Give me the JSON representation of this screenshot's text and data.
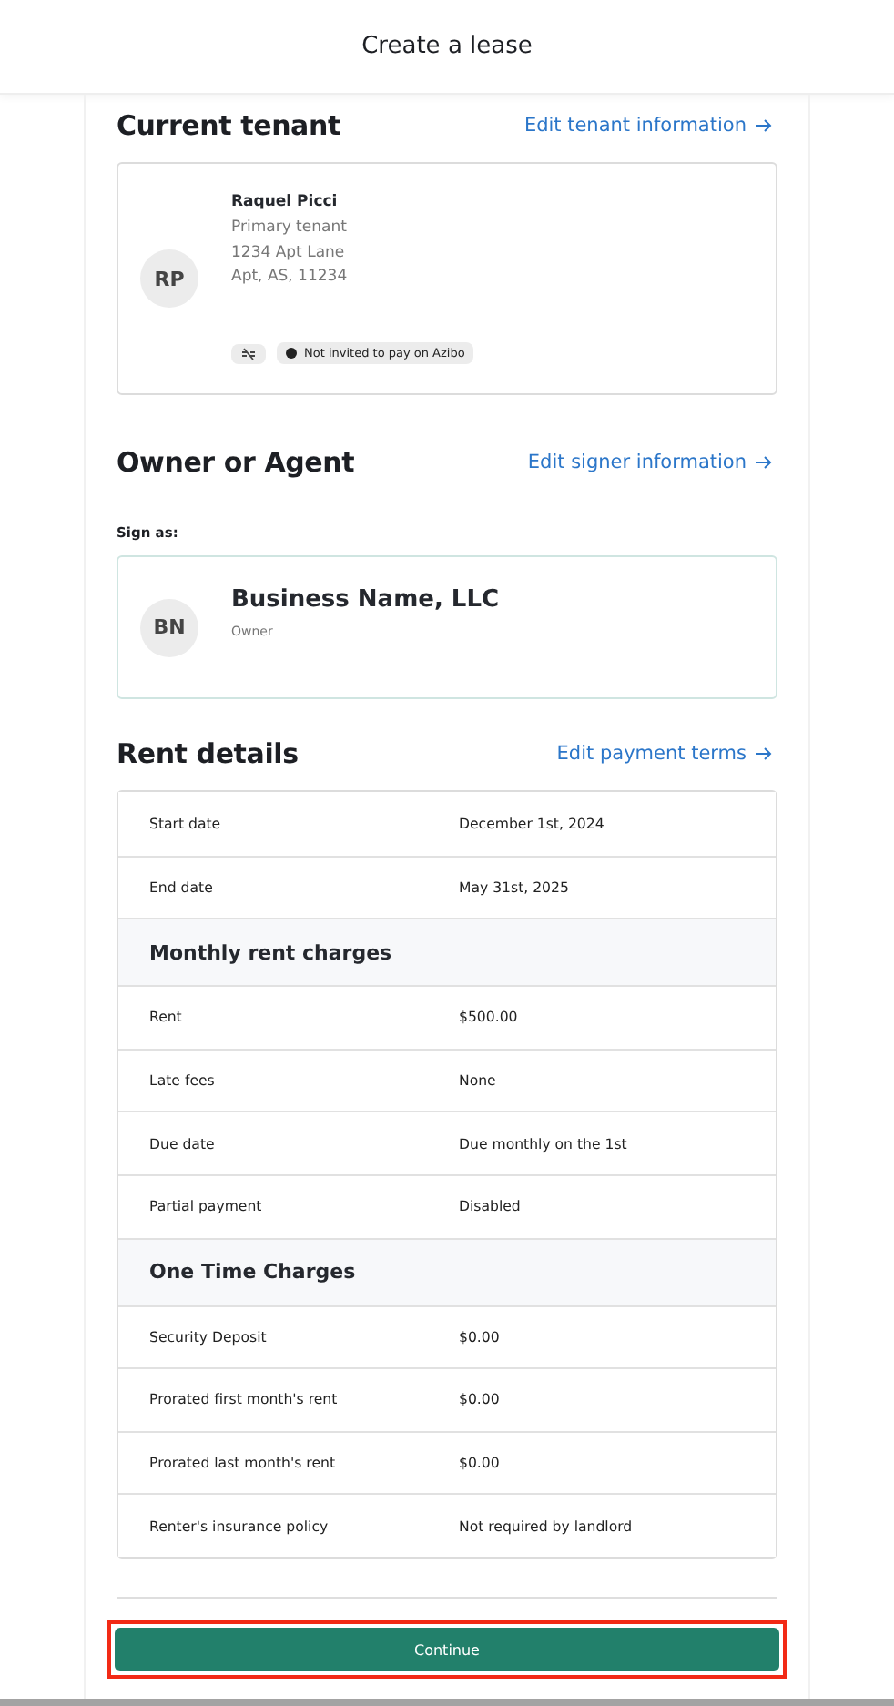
{
  "header": {
    "title": "Create a lease"
  },
  "tenant": {
    "heading": "Current tenant",
    "edit_link": "Edit tenant information",
    "initials": "RP",
    "name": "Raquel Picci",
    "role": "Primary tenant",
    "address_lines": [
      "1234 Apt Lane",
      "Apt, AS, 11234"
    ],
    "invite_status": "Not invited to pay on Azibo"
  },
  "owner": {
    "heading": "Owner or Agent",
    "edit_link": "Edit signer information",
    "sign_as_label": "Sign as:",
    "initials": "BN",
    "name": "Business Name, LLC",
    "role": "Owner"
  },
  "rent": {
    "heading": "Rent details",
    "edit_link": "Edit payment terms",
    "rows": [
      {
        "kind": "row",
        "label": "Start date",
        "value": "December 1st, 2024"
      },
      {
        "kind": "row",
        "label": "End date",
        "value": "May 31st, 2025"
      },
      {
        "kind": "section",
        "label": "Monthly rent charges"
      },
      {
        "kind": "row",
        "label": "Rent",
        "value": "$500.00"
      },
      {
        "kind": "row",
        "label": "Late fees",
        "value": "None"
      },
      {
        "kind": "row",
        "label": "Due date",
        "value": "Due monthly on the 1st"
      },
      {
        "kind": "row",
        "label": "Partial payment",
        "value": "Disabled"
      },
      {
        "kind": "section",
        "label": "One Time Charges"
      },
      {
        "kind": "row",
        "label": "Security Deposit",
        "value": "$0.00"
      },
      {
        "kind": "row",
        "label": "Prorated first month's rent",
        "value": "$0.00"
      },
      {
        "kind": "row",
        "label": "Prorated last month's rent",
        "value": "$0.00"
      },
      {
        "kind": "row",
        "label": "Renter's insurance policy",
        "value": "Not required by landlord"
      }
    ]
  },
  "continue_button": {
    "label": "Continue",
    "highlighted": true
  }
}
